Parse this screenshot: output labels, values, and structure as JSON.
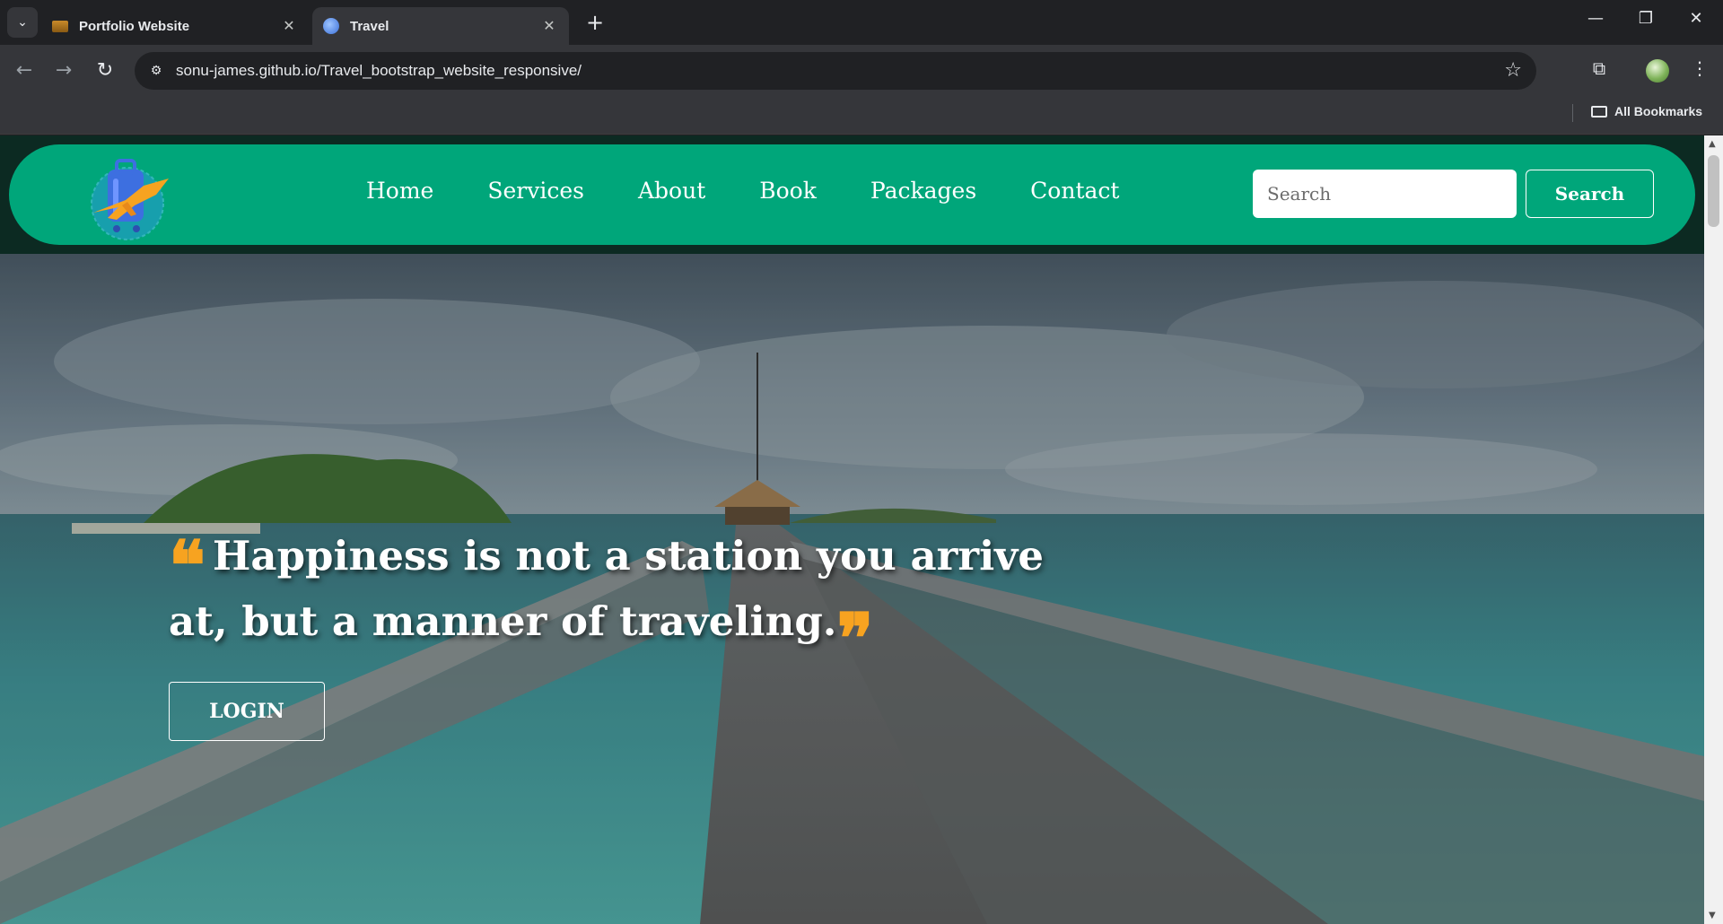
{
  "browser": {
    "tabs": [
      {
        "title": "Portfolio Website",
        "active": false
      },
      {
        "title": "Travel",
        "active": true
      }
    ],
    "url": "sonu-james.github.io/Travel_bootstrap_website_responsive/",
    "bookmarks_label": "All Bookmarks",
    "icons": {
      "tab_menu": "chevron-down-icon",
      "new_tab": "plus-icon",
      "back": "arrow-left-icon",
      "forward": "arrow-right-icon",
      "reload": "reload-icon",
      "site_info": "tune-icon",
      "bookmark_star": "star-icon",
      "extensions": "puzzle-icon",
      "menu": "kebab-menu-icon",
      "minimize": "minimize-icon",
      "restore": "restore-icon",
      "close": "close-icon"
    },
    "glyphs": {
      "tab_menu": "⌄",
      "tab_close": "✕",
      "new_tab": "+",
      "back": "←",
      "forward": "→",
      "reload": "↻",
      "site_info": "⚙",
      "star": "☆",
      "extensions": "⧉",
      "menu": "⋮",
      "minimize": "—",
      "restore": "❐",
      "close": "✕",
      "scroll_up": "▲",
      "scroll_down": "▼"
    }
  },
  "site": {
    "nav": {
      "links": [
        "Home",
        "Services",
        "About",
        "Book",
        "Packages",
        "Contact"
      ],
      "search_placeholder": "Search",
      "search_button": "Search"
    },
    "hero": {
      "quote_open": "❝",
      "quote_text": "Happiness is not a station you arrive at, but a manner of traveling.",
      "quote_close": "❞",
      "login_label": "LOGIN"
    },
    "colors": {
      "navbar": "#00a67a",
      "quote_marks": "#f7a320",
      "text": "#ffffff"
    }
  }
}
